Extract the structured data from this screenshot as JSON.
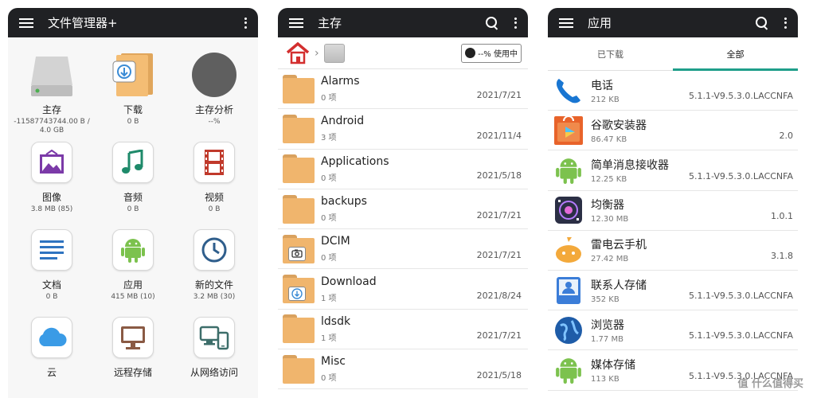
{
  "screen1": {
    "title": "文件管理器+",
    "items": [
      {
        "label": "主存",
        "sub": "-11587743744.00 B / 4.0 GB",
        "icon": "drive-icon"
      },
      {
        "label": "下载",
        "sub": "0 B",
        "icon": "download-folder-icon"
      },
      {
        "label": "主存分析",
        "sub": "--%",
        "icon": "storage-analysis-icon"
      },
      {
        "label": "图像",
        "sub": "3.8 MB (85)",
        "icon": "image-icon"
      },
      {
        "label": "音频",
        "sub": "0 B",
        "icon": "music-icon"
      },
      {
        "label": "视频",
        "sub": "0 B",
        "icon": "film-icon"
      },
      {
        "label": "文档",
        "sub": "0 B",
        "icon": "document-icon"
      },
      {
        "label": "应用",
        "sub": "415 MB (10)",
        "icon": "android-icon"
      },
      {
        "label": "新的文件",
        "sub": "3.2 MB (30)",
        "icon": "clock-icon"
      },
      {
        "label": "云",
        "sub": "",
        "icon": "cloud-icon"
      },
      {
        "label": "远程存储",
        "sub": "",
        "icon": "monitor-icon"
      },
      {
        "label": "从网络访问",
        "sub": "",
        "icon": "network-devices-icon"
      }
    ]
  },
  "screen2": {
    "title": "主存",
    "usage_label": "--% 使用中",
    "folders": [
      {
        "name": "Alarms",
        "count": "0 项",
        "date": "2021/7/21",
        "badge": ""
      },
      {
        "name": "Android",
        "count": "3 项",
        "date": "2021/11/4",
        "badge": ""
      },
      {
        "name": "Applications",
        "count": "0 项",
        "date": "2021/5/18",
        "badge": ""
      },
      {
        "name": "backups",
        "count": "0 项",
        "date": "2021/7/21",
        "badge": ""
      },
      {
        "name": "DCIM",
        "count": "0 项",
        "date": "2021/7/21",
        "badge": "camera"
      },
      {
        "name": "Download",
        "count": "1 项",
        "date": "2021/8/24",
        "badge": "download"
      },
      {
        "name": "ldsdk",
        "count": "1 项",
        "date": "2021/7/21",
        "badge": ""
      },
      {
        "name": "Misc",
        "count": "0 项",
        "date": "2021/5/18",
        "badge": ""
      }
    ]
  },
  "screen3": {
    "title": "应用",
    "tabs": [
      "已下载",
      "全部"
    ],
    "apps": [
      {
        "name": "电话",
        "size": "212 KB",
        "version": "5.1.1-V9.5.3.0.LACCNFA",
        "icon": "phone-icon",
        "color": "#1976d2"
      },
      {
        "name": "谷歌安装器",
        "size": "86.47 KB",
        "version": "2.0",
        "icon": "play-store-icon",
        "color": "#e8632a"
      },
      {
        "name": "简单消息接收器",
        "size": "12.25 KB",
        "version": "5.1.1-V9.5.3.0.LACCNFA",
        "icon": "android-icon",
        "color": "#7cc24e"
      },
      {
        "name": "均衡器",
        "size": "12.30 MB",
        "version": "1.0.1",
        "icon": "equalizer-icon",
        "color": "#2b2f45"
      },
      {
        "name": "雷电云手机",
        "size": "27.42 MB",
        "version": "3.1.8",
        "icon": "cloud-phone-icon",
        "color": "#f3a93b"
      },
      {
        "name": "联系人存储",
        "size": "352 KB",
        "version": "5.1.1-V9.5.3.0.LACCNFA",
        "icon": "contacts-icon",
        "color": "#3b7dd8"
      },
      {
        "name": "浏览器",
        "size": "1.77 MB",
        "version": "5.1.1-V9.5.3.0.LACCNFA",
        "icon": "globe-icon",
        "color": "#1e5ca8"
      },
      {
        "name": "媒体存储",
        "size": "113 KB",
        "version": "5.1.1-V9.5.3.0.LACCNFA",
        "icon": "android-icon",
        "color": "#7cc24e"
      }
    ]
  },
  "watermark": "值 什么值得买"
}
